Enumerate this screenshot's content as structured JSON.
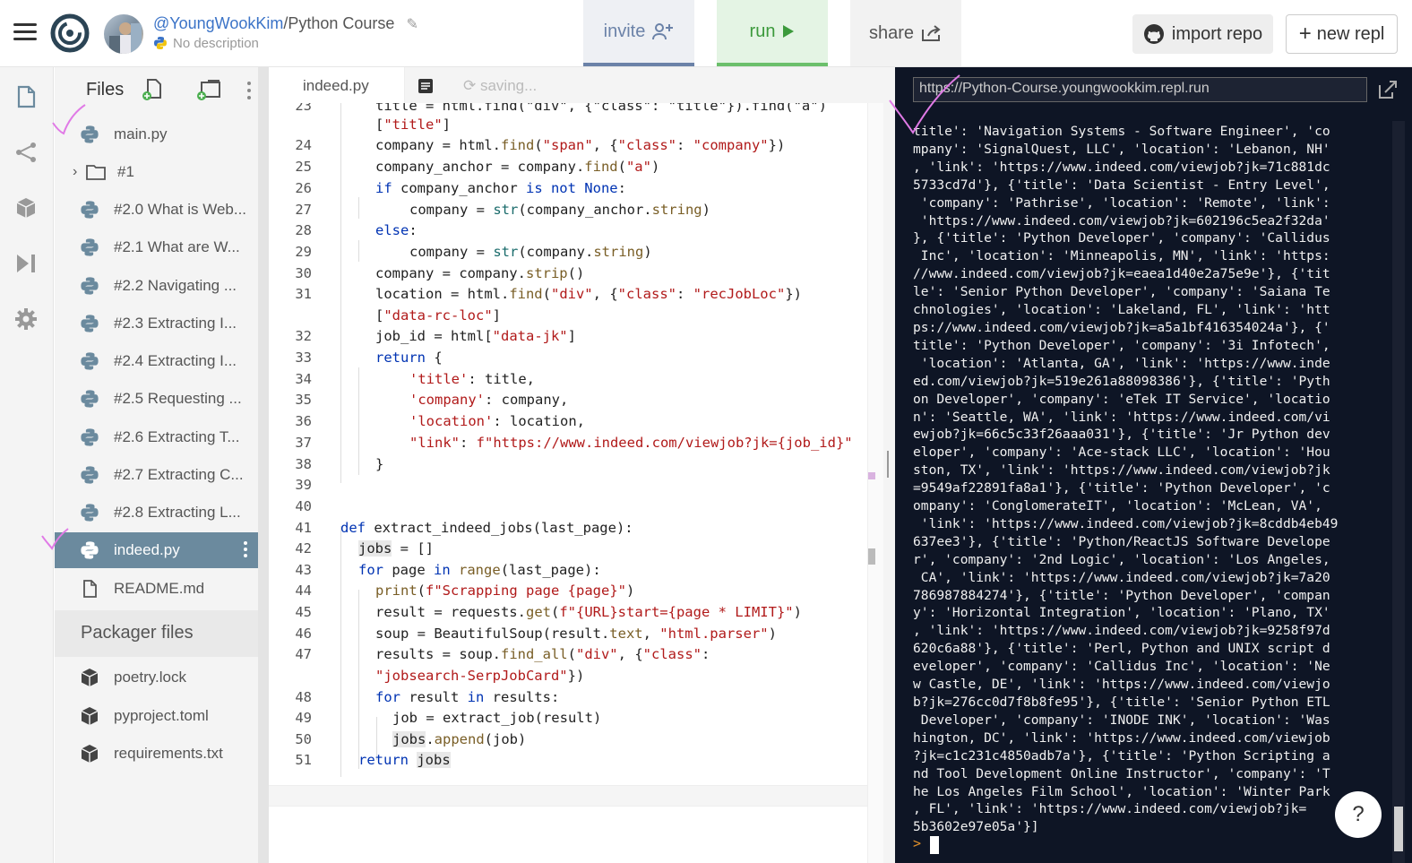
{
  "header": {
    "owner": "@YoungWookKim",
    "separator": "/",
    "repl_name": "Python Course",
    "description": "No description",
    "invite_label": "invite",
    "run_label": "run",
    "share_label": "share",
    "import_label": "import repo",
    "new_repl_label": "new repl"
  },
  "files": {
    "title": "Files",
    "items": [
      {
        "name": "main.py"
      },
      {
        "name": "#1"
      },
      {
        "name": "#2.0 What is Web..."
      },
      {
        "name": "#2.1 What are W..."
      },
      {
        "name": "#2.2 Navigating ..."
      },
      {
        "name": "#2.3 Extracting I..."
      },
      {
        "name": "#2.4 Extracting I..."
      },
      {
        "name": "#2.5 Requesting ..."
      },
      {
        "name": "#2.6 Extracting T..."
      },
      {
        "name": "#2.7 Extracting C..."
      },
      {
        "name": "#2.8 Extracting L..."
      },
      {
        "name": "indeed.py"
      },
      {
        "name": "README.md"
      }
    ],
    "packager_title": "Packager files",
    "packager_items": [
      {
        "name": "poetry.lock"
      },
      {
        "name": "pyproject.toml"
      },
      {
        "name": "requirements.txt"
      }
    ]
  },
  "editor": {
    "tab_label": "indeed.py",
    "status": "saving...",
    "line_numbers": [
      "23",
      "24",
      "25",
      "26",
      "27",
      "28",
      "29",
      "30",
      "31",
      "32",
      "33",
      "34",
      "35",
      "36",
      "37",
      "38",
      "39",
      "40",
      "41",
      "42",
      "43",
      "44",
      "45",
      "46",
      "47",
      "48",
      "49",
      "50",
      "51"
    ]
  },
  "console": {
    "url": "https://Python-Course.youngwookkim.repl.run",
    "output_lines": [
      "title': 'Navigation Systems - Software Engineer', 'co",
      "mpany': 'SignalQuest, LLC', 'location': 'Lebanon, NH'",
      ", 'link': 'https://www.indeed.com/viewjob?jk=71c881dc",
      "5733cd7d'}, {'title': 'Data Scientist - Entry Level',",
      " 'company': 'Pathrise', 'location': 'Remote', 'link':",
      " 'https://www.indeed.com/viewjob?jk=602196c5ea2f32da'",
      "}, {'title': 'Python Developer', 'company': 'Callidus",
      " Inc', 'location': 'Minneapolis, MN', 'link': 'https:",
      "//www.indeed.com/viewjob?jk=eaea1d40e2a75e9e'}, {'tit",
      "le': 'Senior Python Developer', 'company': 'Saiana Te",
      "chnologies', 'location': 'Lakeland, FL', 'link': 'htt",
      "ps://www.indeed.com/viewjob?jk=a5a1bf416354024a'}, {'",
      "title': 'Python Developer', 'company': '3i Infotech',",
      " 'location': 'Atlanta, GA', 'link': 'https://www.inde",
      "ed.com/viewjob?jk=519e261a88098386'}, {'title': 'Pyth",
      "on Developer', 'company': 'eTek IT Service', 'locatio",
      "n': 'Seattle, WA', 'link': 'https://www.indeed.com/vi",
      "ewjob?jk=66c5c33f26aaa031'}, {'title': 'Jr Python dev",
      "eloper', 'company': 'Ace-stack LLC', 'location': 'Hou",
      "ston, TX', 'link': 'https://www.indeed.com/viewjob?jk",
      "=9549af22891fa8a1'}, {'title': 'Python Developer', 'c",
      "ompany': 'ConglomerateIT', 'location': 'McLean, VA',",
      " 'link': 'https://www.indeed.com/viewjob?jk=8cddb4eb49",
      "637ee3'}, {'title': 'Python/ReactJS Software Develope",
      "r', 'company': '2nd Logic', 'location': 'Los Angeles,",
      " CA', 'link': 'https://www.indeed.com/viewjob?jk=7a20",
      "786987884274'}, {'title': 'Python Developer', 'compan",
      "y': 'Horizontal Integration', 'location': 'Plano, TX'",
      ", 'link': 'https://www.indeed.com/viewjob?jk=9258f97d",
      "620c6a88'}, {'title': 'Perl, Python and UNIX script d",
      "eveloper', 'company': 'Callidus Inc', 'location': 'Ne",
      "w Castle, DE', 'link': 'https://www.indeed.com/viewjo",
      "b?jk=276cc0d7f8b8fe95'}, {'title': 'Senior Python ETL",
      " Developer', 'company': 'INODE INK', 'location': 'Was",
      "hington, DC', 'link': 'https://www.indeed.com/viewjob",
      "?jk=c1c231c4850adb7a'}, {'title': 'Python Scripting a",
      "nd Tool Development Online Instructor', 'company': 'T",
      "he Los Angeles Film School', 'location': 'Winter Park",
      ", FL', 'link': 'https://www.indeed.com/viewjob?jk=",
      "5b3602e97e05a'}]"
    ],
    "prompt": ">",
    "help_label": "?"
  },
  "colors": {
    "accent_invite": "#6b82a8",
    "accent_run": "#3c9a3c",
    "console_bg": "#0e1525",
    "active_file": "#6b8a9e",
    "annotation": "#e07ae6"
  }
}
